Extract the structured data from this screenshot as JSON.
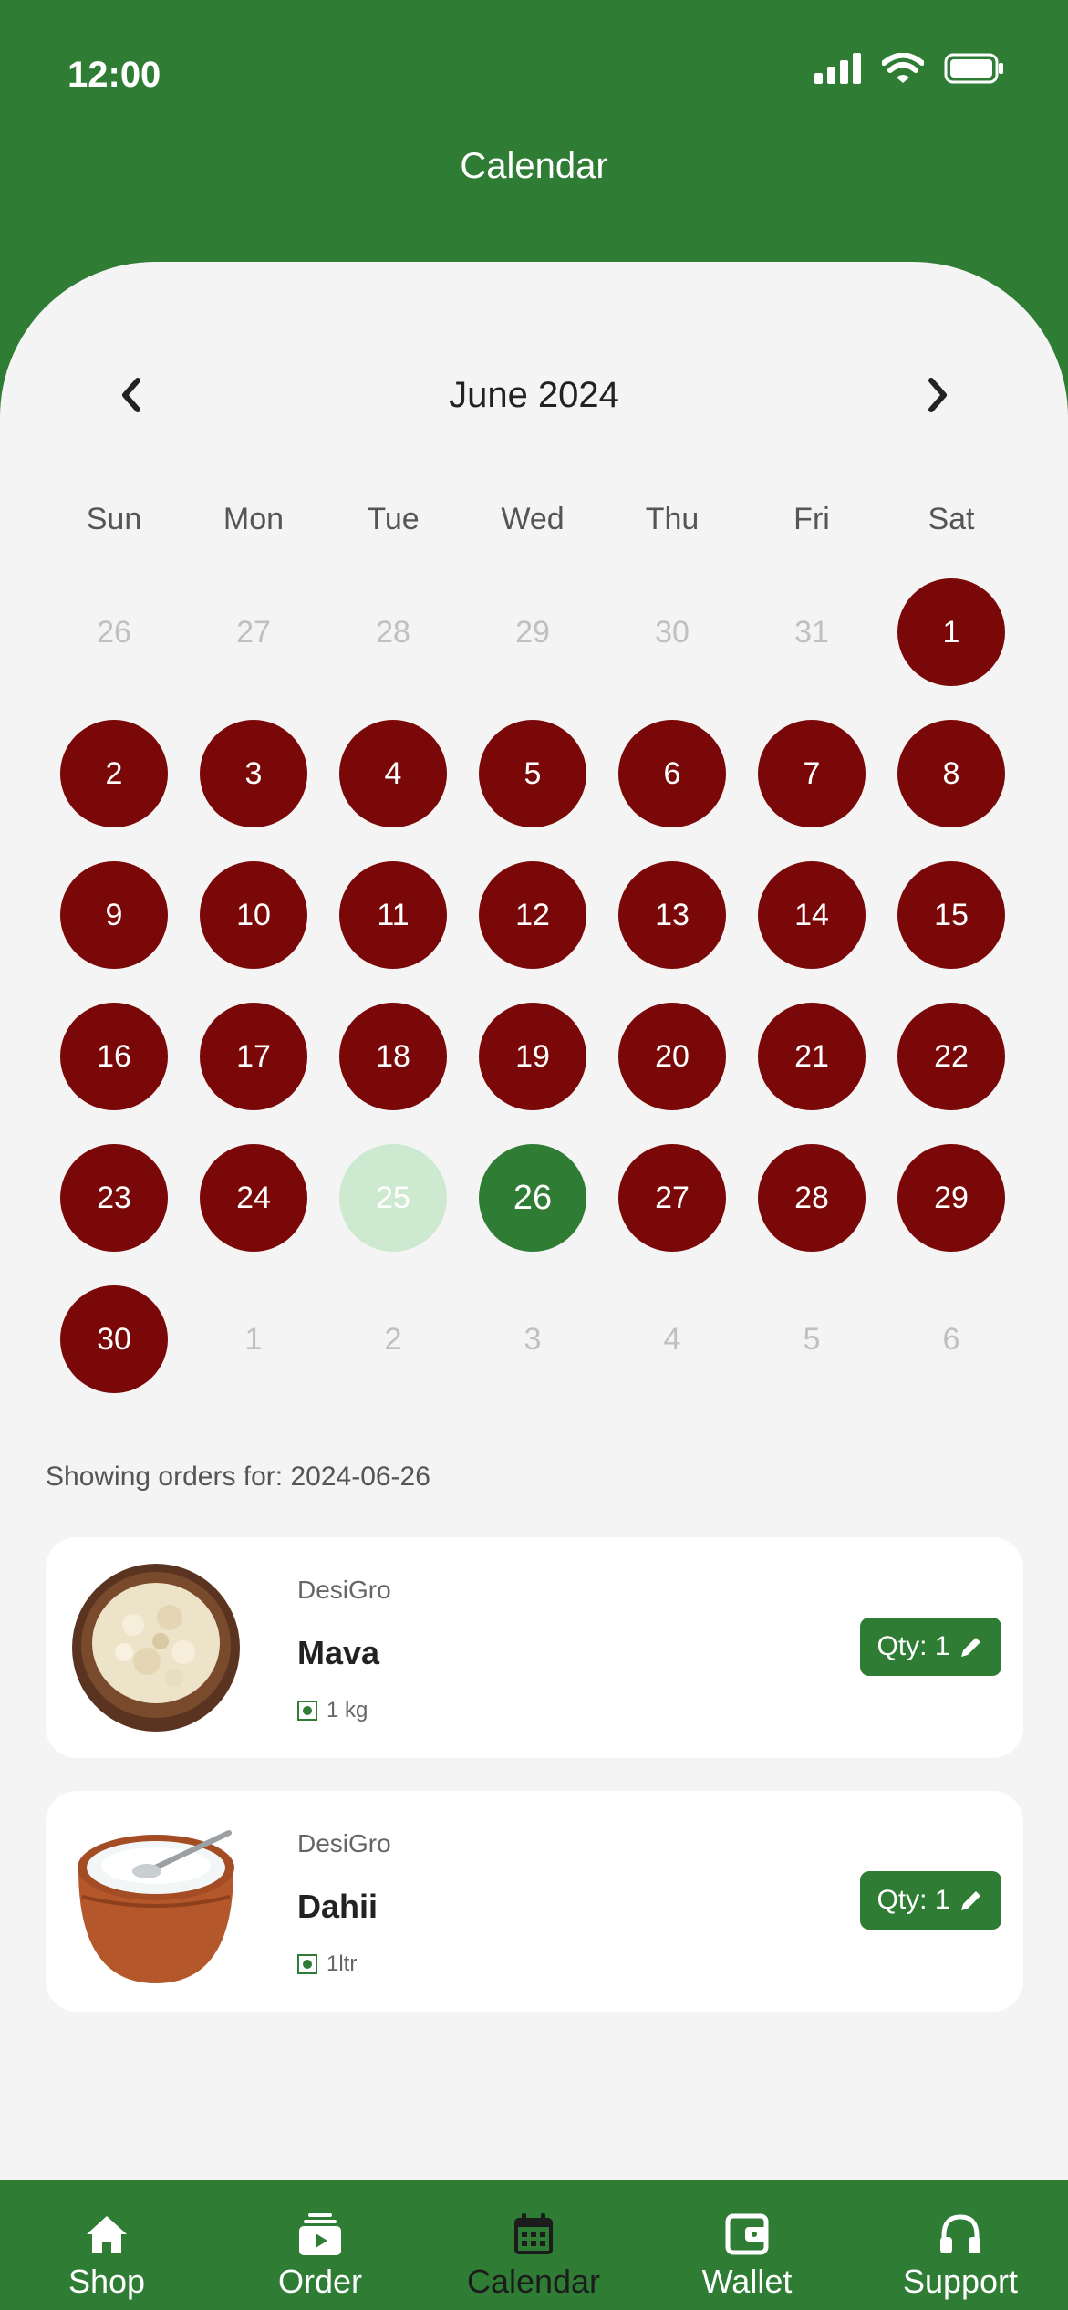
{
  "status": {
    "time": "12:00"
  },
  "header": {
    "title": "Calendar"
  },
  "calendar": {
    "month_title": "June 2024",
    "weekdays": [
      "Sun",
      "Mon",
      "Tue",
      "Wed",
      "Thu",
      "Fri",
      "Sat"
    ],
    "days": [
      {
        "label": "26",
        "state": "muted"
      },
      {
        "label": "27",
        "state": "muted"
      },
      {
        "label": "28",
        "state": "muted"
      },
      {
        "label": "29",
        "state": "muted"
      },
      {
        "label": "30",
        "state": "muted"
      },
      {
        "label": "31",
        "state": "muted"
      },
      {
        "label": "1",
        "state": "ordered"
      },
      {
        "label": "2",
        "state": "ordered"
      },
      {
        "label": "3",
        "state": "ordered"
      },
      {
        "label": "4",
        "state": "ordered"
      },
      {
        "label": "5",
        "state": "ordered"
      },
      {
        "label": "6",
        "state": "ordered"
      },
      {
        "label": "7",
        "state": "ordered"
      },
      {
        "label": "8",
        "state": "ordered"
      },
      {
        "label": "9",
        "state": "ordered"
      },
      {
        "label": "10",
        "state": "ordered"
      },
      {
        "label": "11",
        "state": "ordered"
      },
      {
        "label": "12",
        "state": "ordered"
      },
      {
        "label": "13",
        "state": "ordered"
      },
      {
        "label": "14",
        "state": "ordered"
      },
      {
        "label": "15",
        "state": "ordered"
      },
      {
        "label": "16",
        "state": "ordered"
      },
      {
        "label": "17",
        "state": "ordered"
      },
      {
        "label": "18",
        "state": "ordered"
      },
      {
        "label": "19",
        "state": "ordered"
      },
      {
        "label": "20",
        "state": "ordered"
      },
      {
        "label": "21",
        "state": "ordered"
      },
      {
        "label": "22",
        "state": "ordered"
      },
      {
        "label": "23",
        "state": "ordered"
      },
      {
        "label": "24",
        "state": "ordered"
      },
      {
        "label": "25",
        "state": "today"
      },
      {
        "label": "26",
        "state": "selected"
      },
      {
        "label": "27",
        "state": "ordered"
      },
      {
        "label": "28",
        "state": "ordered"
      },
      {
        "label": "29",
        "state": "ordered"
      },
      {
        "label": "30",
        "state": "ordered"
      },
      {
        "label": "1",
        "state": "muted"
      },
      {
        "label": "2",
        "state": "muted"
      },
      {
        "label": "3",
        "state": "muted"
      },
      {
        "label": "4",
        "state": "muted"
      },
      {
        "label": "5",
        "state": "muted"
      },
      {
        "label": "6",
        "state": "muted"
      }
    ]
  },
  "orders": {
    "showing_text": "Showing orders for: 2024-06-26",
    "items": [
      {
        "brand": "DesiGro",
        "name": "Mava",
        "unit": "1 kg",
        "qty": "Qty: 1",
        "image": "mava-bowl-image"
      },
      {
        "brand": "DesiGro",
        "name": "Dahii",
        "unit": "1ltr",
        "qty": "Qty: 1",
        "image": "curd-pot-image"
      }
    ]
  },
  "tabs": [
    {
      "label": "Shop",
      "icon": "home-icon",
      "active": false
    },
    {
      "label": "Order",
      "icon": "order-icon",
      "active": false
    },
    {
      "label": "Calendar",
      "icon": "calendar-icon",
      "active": true
    },
    {
      "label": "Wallet",
      "icon": "wallet-icon",
      "active": false
    },
    {
      "label": "Support",
      "icon": "headphones-icon",
      "active": false
    }
  ],
  "colors": {
    "primary": "#2f7c34",
    "ordered": "#7a0808",
    "today": "#cde9cf",
    "background": "#f4f4f4"
  }
}
